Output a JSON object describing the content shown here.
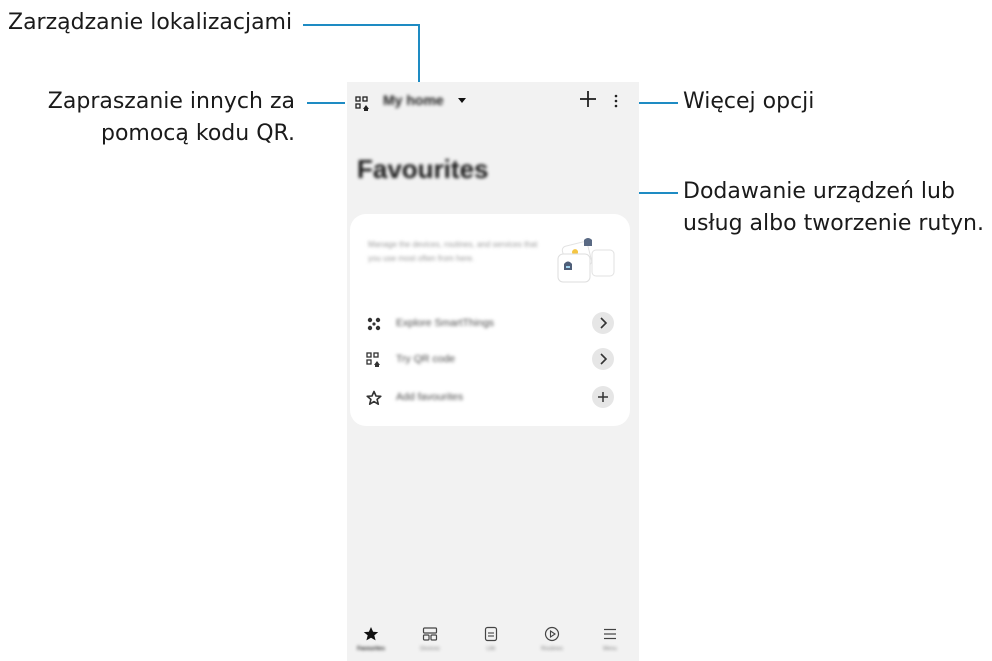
{
  "callouts": {
    "manage_locations": "Zarządzanie lokalizacjami",
    "invite_qr_line1": "Zapraszanie innych za",
    "invite_qr_line2": "pomocą kodu QR.",
    "more_options": "Więcej opcji",
    "add_devices_line1": "Dodawanie urządzeń lub",
    "add_devices_line2": "usług albo tworzenie rutyn."
  },
  "topbar": {
    "location_name": "My home",
    "icons": [
      "qr-invite-icon",
      "caret-down-icon",
      "plus-icon",
      "more-vertical-icon"
    ]
  },
  "main": {
    "title": "Favourites",
    "card": {
      "description": "Manage the devices, routines, and services that you use most often from here.",
      "rows": [
        {
          "icon": "smartthings-icon",
          "label": "Explore SmartThings",
          "action": "chevron-right-icon"
        },
        {
          "icon": "qr-code-icon",
          "label": "Try QR code",
          "action": "chevron-right-icon"
        },
        {
          "icon": "star-outline-icon",
          "label": "Add favourites",
          "action": "plus-icon"
        }
      ]
    }
  },
  "bottom_nav": [
    {
      "label": "Favourites",
      "icon": "star-icon",
      "active": true
    },
    {
      "label": "Devices",
      "icon": "devices-grid-icon",
      "active": false
    },
    {
      "label": "Life",
      "icon": "life-icon",
      "active": false
    },
    {
      "label": "Routines",
      "icon": "play-circle-icon",
      "active": false
    },
    {
      "label": "Menu",
      "icon": "menu-icon",
      "active": false
    }
  ],
  "colors": {
    "callout_line": "#1e8bc3",
    "screen_bg": "#f2f2f2",
    "card_bg": "#ffffff"
  }
}
